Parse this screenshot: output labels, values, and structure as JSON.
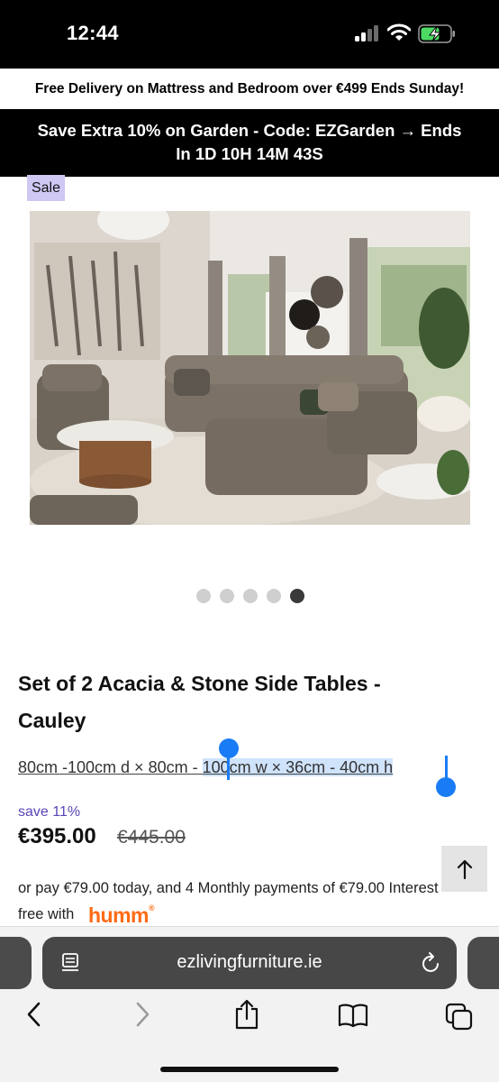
{
  "status_bar": {
    "time": "12:44"
  },
  "promo": {
    "delivery_text": "Free Delivery on Mattress and Bedroom over €499 Ends Sunday!"
  },
  "countdown": {
    "line1": "Save Extra 10% on Garden - Code: EZGarden → Ends",
    "line2": "In 1D 10H 14M 43S"
  },
  "product": {
    "badge": "Sale",
    "title_line1": "Set of 2 Acacia & Stone Side Tables -",
    "title_line2": "Cauley",
    "dimensions_unselected": "80cm -100cm d × 80cm - ",
    "dimensions_selected": "100cm w × 36cm - 40cm h",
    "save_text": "save 11%",
    "price_now": "€395.00",
    "price_was": "€445.00",
    "pay_line1": "or pay €79.00 today, and 4 Monthly payments of €79.00 Interest",
    "pay_line2_prefix": "free with",
    "humm_brand": "humm"
  },
  "carousel": {
    "total": 5,
    "active_index": 4
  },
  "browser": {
    "url": "ezlivingfurniture.ie"
  },
  "colors": {
    "sale_badge": "#cfc8f5",
    "save_text": "#5b45b8",
    "humm_orange": "#ff6a14",
    "selection_blue": "#1a7cf5"
  },
  "icons": [
    "wifi-icon",
    "battery-charging-icon",
    "scroll-to-top-icon",
    "reader-icon",
    "reload-icon",
    "back-icon",
    "forward-icon",
    "share-icon",
    "bookmarks-icon",
    "tabs-icon"
  ]
}
